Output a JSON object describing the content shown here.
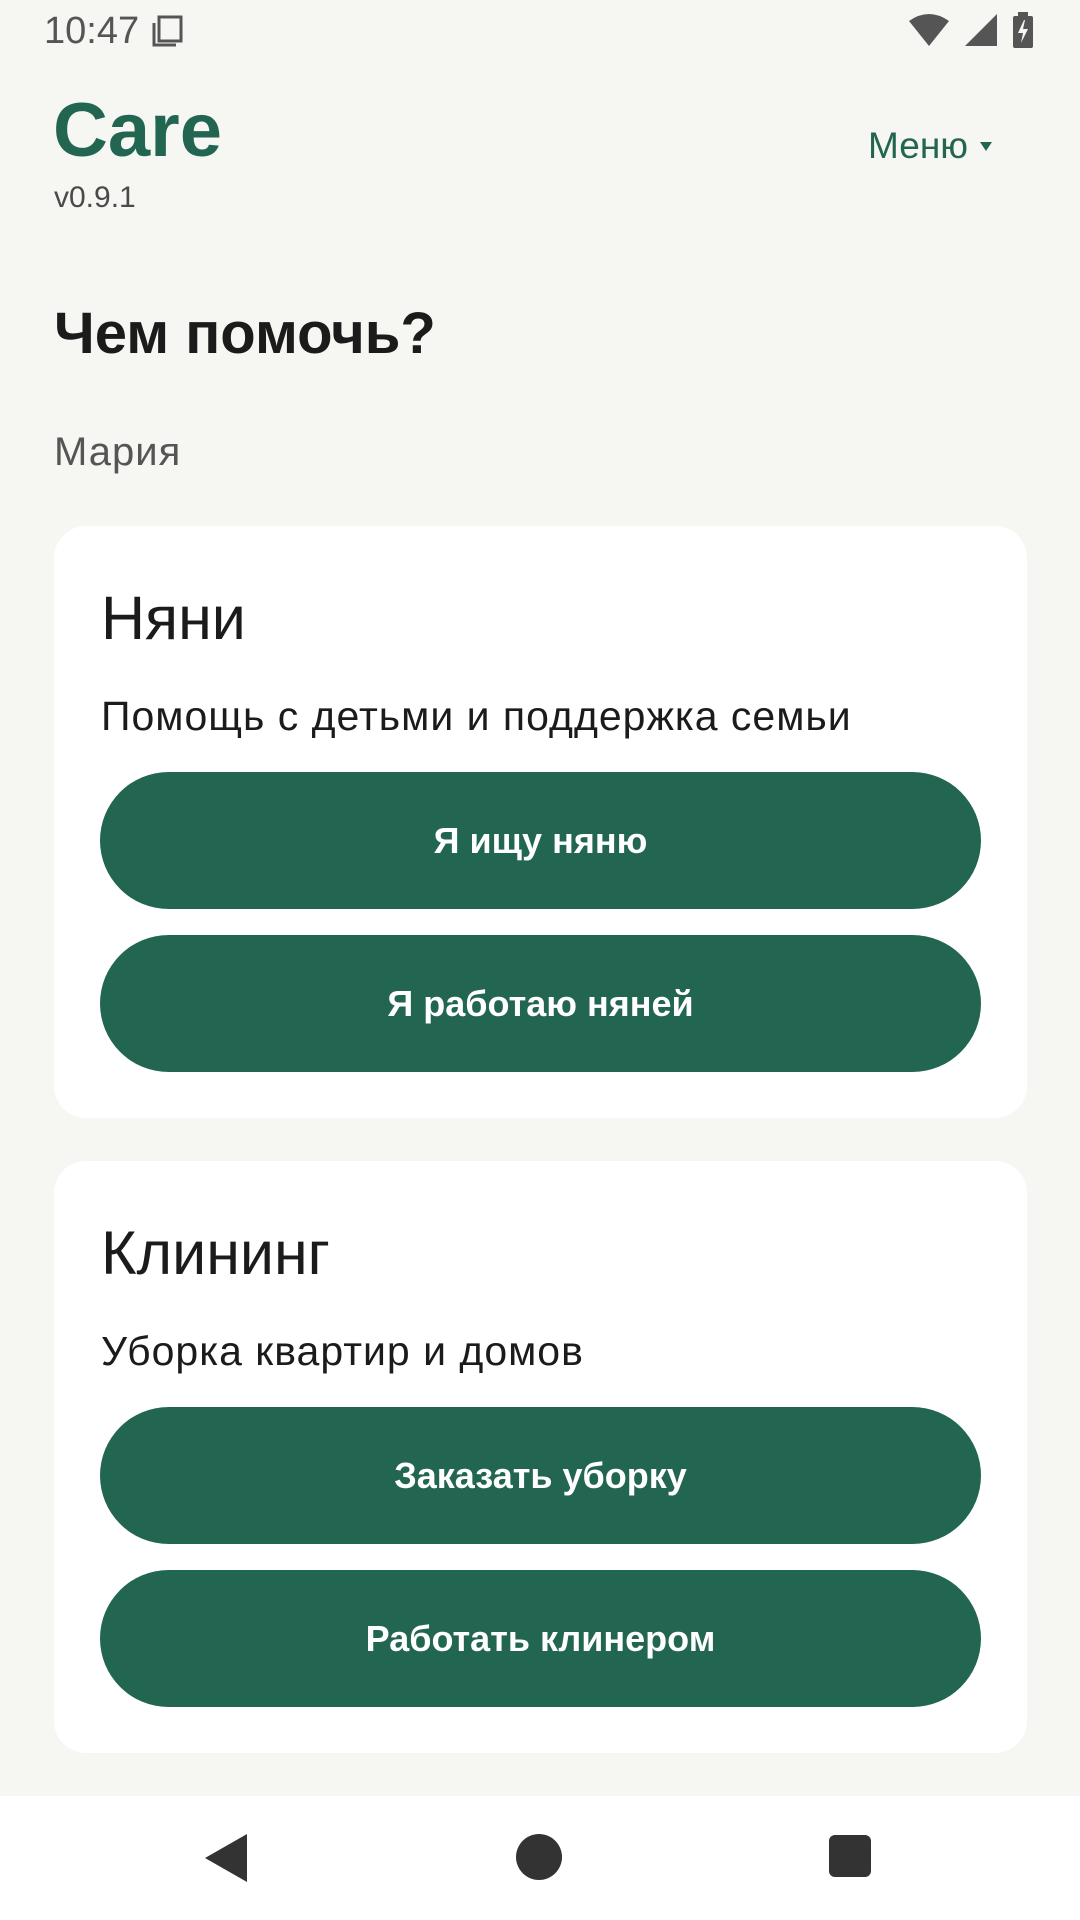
{
  "status_bar": {
    "time": "10:47",
    "icons": [
      "document-icon",
      "wifi-icon",
      "cellular-signal-icon",
      "battery-charging-icon"
    ]
  },
  "header": {
    "app_title": "Care",
    "version": "v0.9.1",
    "menu_label": "Меню"
  },
  "main": {
    "heading": "Чем помочь?",
    "user_name": "Мария",
    "cards": [
      {
        "title": "Няни",
        "subtitle": "Помощь с детьми и поддержка семьи",
        "buttons": [
          "Я ищу няню",
          "Я работаю няней"
        ]
      },
      {
        "title": "Клининг",
        "subtitle": "Уборка квартир и домов",
        "buttons": [
          "Заказать уборку",
          "Работать клинером"
        ]
      }
    ]
  },
  "nav_bar": {
    "icons": [
      "back-icon",
      "home-icon",
      "recents-icon"
    ]
  },
  "colors": {
    "accent": "#226651",
    "background": "#f6f6f3",
    "card": "#ffffff"
  }
}
